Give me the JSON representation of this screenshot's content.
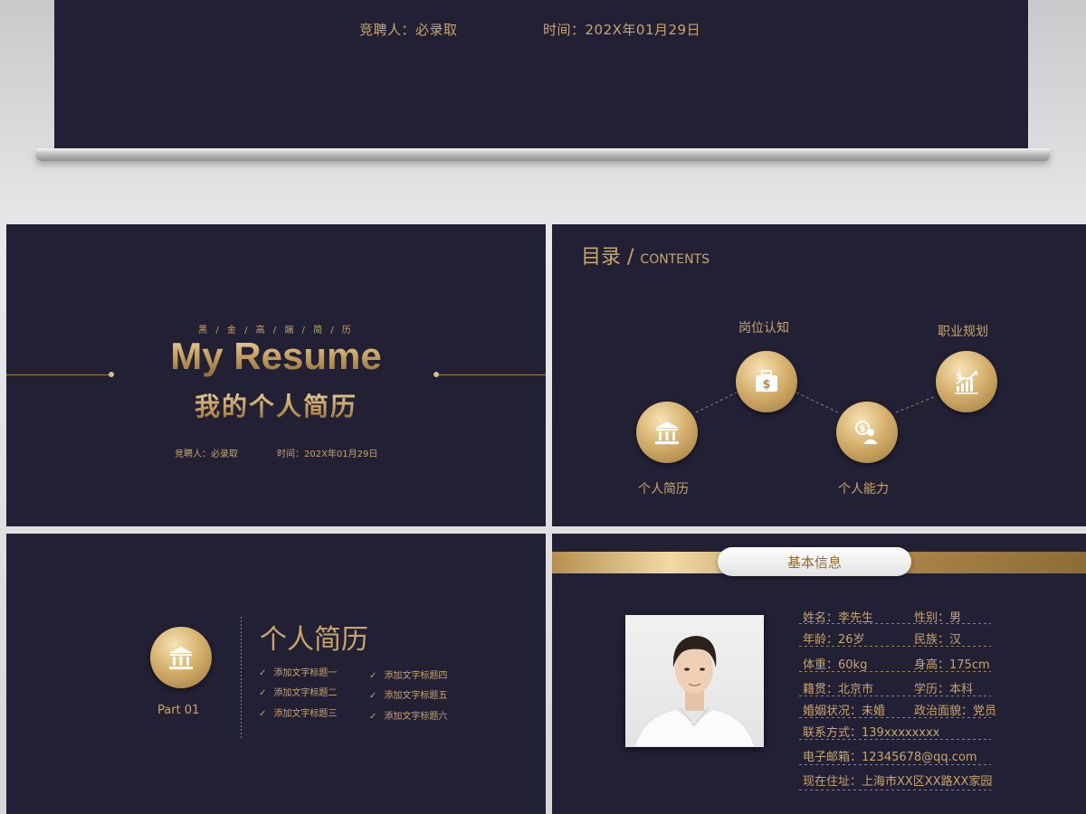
{
  "top_slide": {
    "presenter": "竞聘人：必录取",
    "date": "时间：202X年01月29日"
  },
  "cover": {
    "kicker": "黑 / 金 / 高 / 端 / 简 / 历",
    "title": "My Resume",
    "subtitle": "我的个人简历",
    "presenter": "竞聘人：必录取",
    "date": "时间：202X年01月29日"
  },
  "contents": {
    "title_cn": "目录",
    "separator": " / ",
    "title_en": "CONTENTS",
    "items": [
      {
        "label": "个人简历",
        "icon": "bank-icon"
      },
      {
        "label": "岗位认知",
        "icon": "briefcase-icon"
      },
      {
        "label": "个人能力",
        "icon": "person-dollar-icon"
      },
      {
        "label": "职业规划",
        "icon": "growth-chart-icon"
      }
    ]
  },
  "part": {
    "label": "Part 01",
    "title": "个人简历",
    "check_mark": "✓",
    "items": [
      "添加文字标题一",
      "添加文字标题二",
      "添加文字标题三",
      "添加文字标题四",
      "添加文字标题五",
      "添加文字标题六"
    ]
  },
  "info": {
    "header": "基本信息",
    "name": "姓名：李先生",
    "gender": "性别：男",
    "age": "年龄：26岁",
    "ethnicity": "民族：汉",
    "weight": "体重：60kg",
    "height": "身高：175cm",
    "origin": "籍贯：北京市",
    "education": "学历：本科",
    "marital": "婚姻状况：未婚",
    "political": "政治面貌：党员",
    "phone": "联系方式：139xxxxxxxx",
    "email": "电子邮箱：12345678@qq.com",
    "address": "现在住址：上海市XX区XX路XX家园"
  },
  "colors": {
    "slide_bg": "#222035",
    "gold": "#c9a56a",
    "gold_light": "#f1d9a5",
    "gold_dark": "#8d6a34"
  }
}
